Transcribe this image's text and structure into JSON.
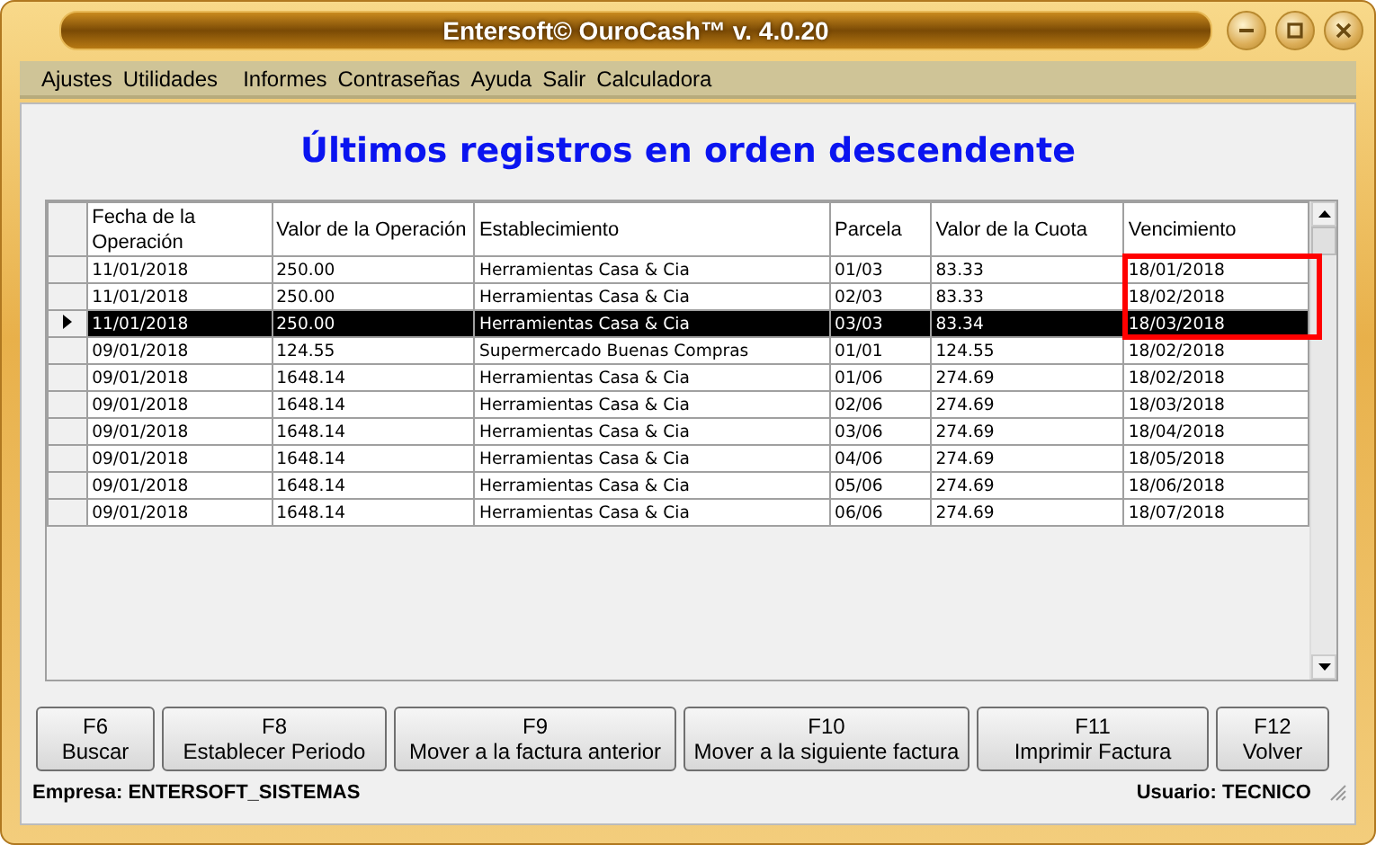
{
  "window": {
    "title": "Entersoft© OuroCash™ v. 4.0.20"
  },
  "menu": [
    "Ajustes",
    "Utilidades",
    "Informes",
    "Contraseñas",
    "Ayuda",
    "Salir",
    "Calculadora"
  ],
  "heading": "Últimos registros en orden descendente",
  "table": {
    "columns": [
      "Fecha de la Operación",
      "Valor de la Operación",
      "Establecimiento",
      "Parcela",
      "Valor de la Cuota",
      "Vencimiento"
    ],
    "rows": [
      {
        "cells": [
          "11/01/2018",
          "250.00",
          "Herramientas Casa & Cia",
          "01/03",
          "83.33",
          "18/01/2018"
        ],
        "selected": false,
        "marked": true
      },
      {
        "cells": [
          "11/01/2018",
          "250.00",
          "Herramientas Casa & Cia",
          "02/03",
          "83.33",
          "18/02/2018"
        ],
        "selected": false,
        "marked": true
      },
      {
        "cells": [
          "11/01/2018",
          "250.00",
          "Herramientas Casa & Cia",
          "03/03",
          "83.34",
          "18/03/2018"
        ],
        "selected": true,
        "marked": true
      },
      {
        "cells": [
          "09/01/2018",
          "124.55",
          "Supermercado Buenas Compras",
          "01/01",
          "124.55",
          "18/02/2018"
        ],
        "selected": false,
        "marked": false
      },
      {
        "cells": [
          "09/01/2018",
          "1648.14",
          "Herramientas Casa & Cia",
          "01/06",
          "274.69",
          "18/02/2018"
        ],
        "selected": false,
        "marked": false
      },
      {
        "cells": [
          "09/01/2018",
          "1648.14",
          "Herramientas Casa & Cia",
          "02/06",
          "274.69",
          "18/03/2018"
        ],
        "selected": false,
        "marked": false
      },
      {
        "cells": [
          "09/01/2018",
          "1648.14",
          "Herramientas Casa & Cia",
          "03/06",
          "274.69",
          "18/04/2018"
        ],
        "selected": false,
        "marked": false
      },
      {
        "cells": [
          "09/01/2018",
          "1648.14",
          "Herramientas Casa & Cia",
          "04/06",
          "274.69",
          "18/05/2018"
        ],
        "selected": false,
        "marked": false
      },
      {
        "cells": [
          "09/01/2018",
          "1648.14",
          "Herramientas Casa & Cia",
          "05/06",
          "274.69",
          "18/06/2018"
        ],
        "selected": false,
        "marked": false
      },
      {
        "cells": [
          "09/01/2018",
          "1648.14",
          "Herramientas Casa & Cia",
          "06/06",
          "274.69",
          "18/07/2018"
        ],
        "selected": false,
        "marked": false
      }
    ]
  },
  "buttons": [
    {
      "key": "F6",
      "label": "Buscar"
    },
    {
      "key": "F8",
      "label": "Establecer Periodo"
    },
    {
      "key": "F9",
      "label": "Mover a la factura anterior"
    },
    {
      "key": "F10",
      "label": "Mover a la siguiente factura"
    },
    {
      "key": "F11",
      "label": "Imprimir Factura"
    },
    {
      "key": "F12",
      "label": "Volver"
    }
  ],
  "status_bar": {
    "company": "Empresa: ENTERSOFT_SISTEMAS",
    "user": "Usuario: TECNICO"
  }
}
